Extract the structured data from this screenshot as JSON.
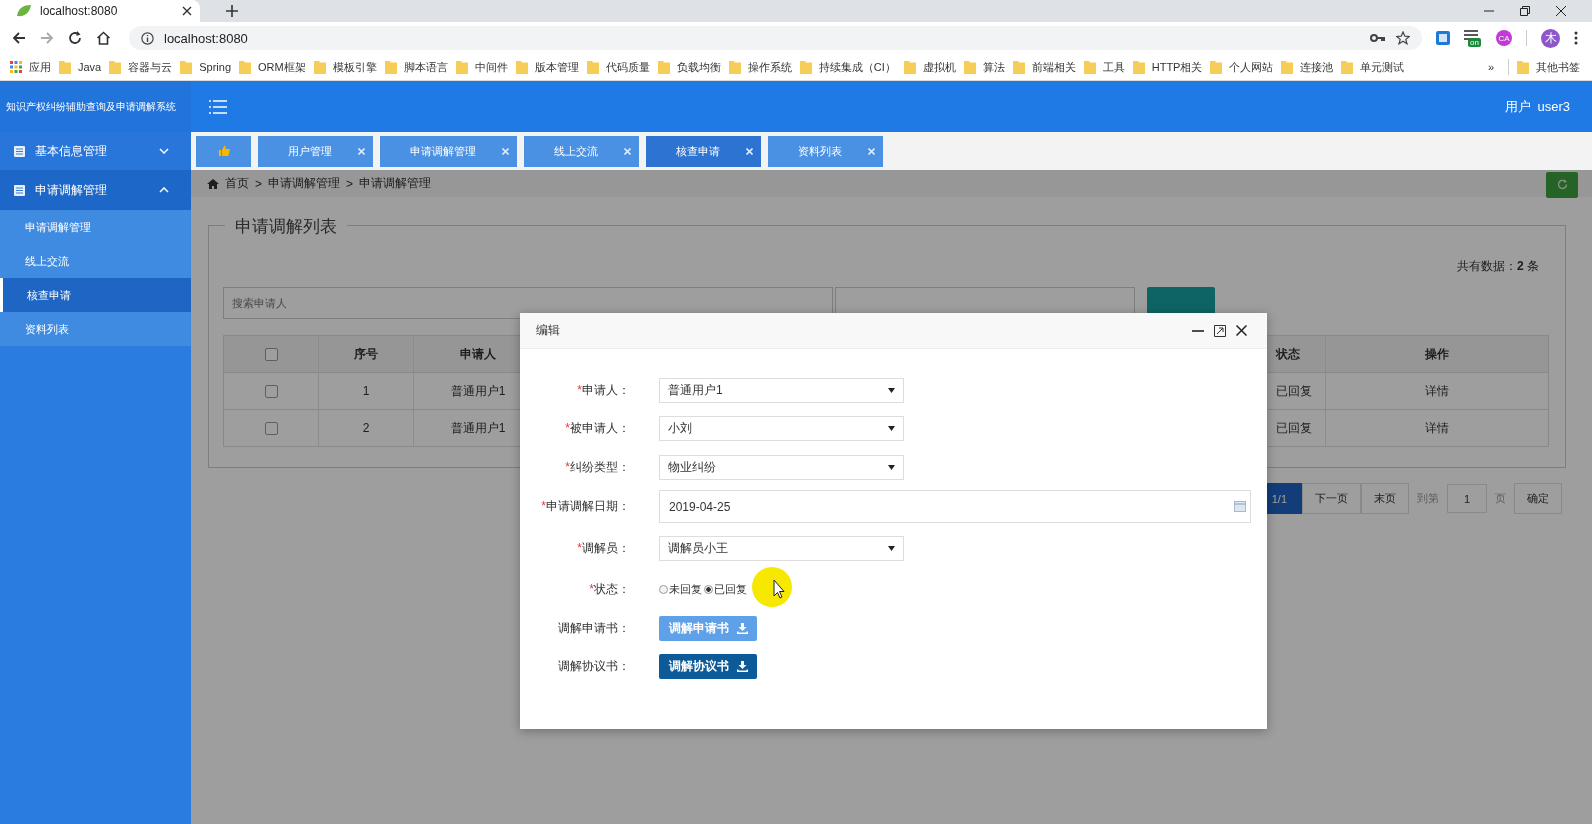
{
  "browser": {
    "tab_title": "localhost:8080",
    "url": "localhost:8080",
    "apps_label": "应用",
    "bookmarks": [
      "Java",
      "容器与云",
      "Spring",
      "ORM框架",
      "模板引擎",
      "脚本语言",
      "中间件",
      "版本管理",
      "代码质量",
      "负载均衡",
      "操作系统",
      "持续集成（CI）",
      "虚拟机",
      "算法",
      "前端相关",
      "工具",
      "HTTP相关",
      "个人网站",
      "连接池",
      "单元测试"
    ],
    "more": "»",
    "other_bookmarks": "其他书签",
    "extension_badge": "on",
    "extension_label": "CA",
    "avatar": "木"
  },
  "app": {
    "title": "知识产权纠纷辅助查询及申请调解系统",
    "user_label": "用户",
    "user_name": "user3"
  },
  "sidebar": {
    "groups": [
      {
        "label": "基本信息管理",
        "expanded": false
      },
      {
        "label": "申请调解管理",
        "expanded": true,
        "children": [
          {
            "label": "申请调解管理",
            "selected": false
          },
          {
            "label": "线上交流",
            "selected": false
          },
          {
            "label": "核查申请",
            "selected": true
          },
          {
            "label": "资料列表",
            "selected": false
          }
        ]
      }
    ]
  },
  "tabs": [
    {
      "kind": "home",
      "selected": false
    },
    {
      "kind": "page",
      "label": "用户管理",
      "selected": false
    },
    {
      "kind": "page",
      "label": "申请调解管理",
      "selected": false
    },
    {
      "kind": "page",
      "label": "线上交流",
      "selected": false
    },
    {
      "kind": "page",
      "label": "核查申请",
      "selected": true
    },
    {
      "kind": "page",
      "label": "资料列表",
      "selected": false
    }
  ],
  "breadcrumb": {
    "items": [
      "首页",
      "申请调解管理",
      "申请调解管理"
    ],
    "separator": ">"
  },
  "list": {
    "legend": "申请调解列表",
    "total": "共有数据：**2** 条",
    "search_placeholder": "搜索申请人"
  },
  "table": {
    "all_checked": false,
    "columns": [
      "序号",
      "申请人",
      "状态",
      "操作"
    ],
    "rows": [
      {
        "checked": false,
        "cells": [
          "1",
          "普通用户1",
          "已回复",
          "详情"
        ]
      },
      {
        "checked": false,
        "cells": [
          "2",
          "普通用户1",
          "已回复",
          "详情"
        ]
      }
    ]
  },
  "pagination": {
    "current": "1/1",
    "next": "下一页",
    "last": "末页",
    "goto_label": "到第",
    "goto_value": "1",
    "page_unit": "页",
    "confirm": "确定"
  },
  "dialog": {
    "title": "编辑",
    "required_mark": "*",
    "fields": [
      {
        "kind": "select",
        "label": "申请人：",
        "required": true,
        "value": "普通用户1"
      },
      {
        "kind": "select",
        "label": "被申请人：",
        "required": true,
        "value": "小刘"
      },
      {
        "kind": "select",
        "label": "纠纷类型：",
        "required": true,
        "value": "物业纠纷"
      },
      {
        "kind": "date",
        "label": "申请调解日期：",
        "required": true,
        "value": "2019-04-25"
      },
      {
        "kind": "select",
        "label": "调解员：",
        "required": true,
        "value": "调解员小王"
      },
      {
        "kind": "radio",
        "label": "状态：",
        "required": true,
        "options": [
          {
            "label": "未回复",
            "selected": false
          },
          {
            "label": "已回复",
            "selected": true
          }
        ]
      },
      {
        "kind": "button",
        "label": "调解申请书：",
        "required": false,
        "button": "调解申请书"
      },
      {
        "kind": "button",
        "label": "调解协议书：",
        "required": false,
        "button": "调解协议书"
      }
    ]
  }
}
